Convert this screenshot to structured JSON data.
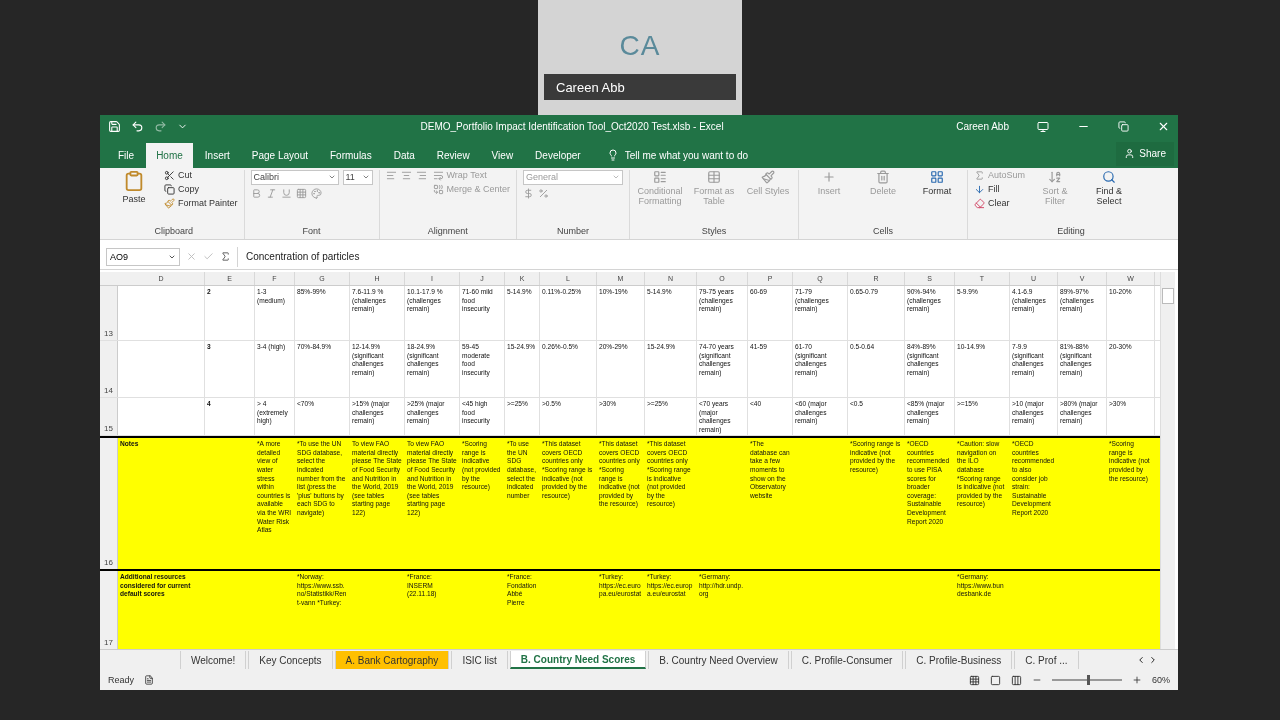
{
  "call": {
    "initials": "CA",
    "name": "Careen Abb"
  },
  "window": {
    "title": "DEMO_Portfolio Impact Identification Tool_Oct2020 Test.xlsb - Excel",
    "user": "Careen Abb"
  },
  "menu_tabs": [
    {
      "label": "File",
      "selected": false
    },
    {
      "label": "Home",
      "selected": true
    },
    {
      "label": "Insert",
      "selected": false
    },
    {
      "label": "Page Layout",
      "selected": false
    },
    {
      "label": "Formulas",
      "selected": false
    },
    {
      "label": "Data",
      "selected": false
    },
    {
      "label": "Review",
      "selected": false
    },
    {
      "label": "View",
      "selected": false
    },
    {
      "label": "Developer",
      "selected": false
    }
  ],
  "tell_me": {
    "placeholder": "Tell me what you want to do"
  },
  "share": "Share",
  "ribbon": {
    "clipboard": {
      "label": "Clipboard",
      "paste": "Paste",
      "cut": "Cut",
      "copy": "Copy",
      "format_painter": "Format Painter"
    },
    "font": {
      "label": "Font",
      "name": "Calibri",
      "size": "11"
    },
    "alignment": {
      "label": "Alignment",
      "wrap_text": "Wrap Text",
      "merge_center": "Merge & Center"
    },
    "number": {
      "label": "Number",
      "format": "General"
    },
    "styles": {
      "label": "Styles",
      "conditional_formatting": "Conditional Formatting",
      "format_as_table": "Format as Table",
      "cell_styles": "Cell Styles"
    },
    "cells": {
      "label": "Cells",
      "insert": "Insert",
      "delete": "Delete",
      "format": "Format"
    },
    "editing": {
      "label": "Editing",
      "autosum": "AutoSum",
      "fill": "Fill",
      "clear": "Clear",
      "sort_filter": "Sort & Filter",
      "find_select": "Find & Select"
    }
  },
  "formula_bar": {
    "name_box": "AO9",
    "value": "Concentration of particles"
  },
  "columns": [
    "D",
    "E",
    "F",
    "G",
    "H",
    "I",
    "J",
    "K",
    "L",
    "M",
    "N",
    "O",
    "P",
    "Q",
    "R",
    "S",
    "T",
    "U",
    "V",
    "W"
  ],
  "rows": [
    {
      "number": "13",
      "kind": "plain",
      "cells": [
        "",
        "2",
        "1-3 (medium)",
        "85%-99%",
        "7.6-11.9 % (challenges remain)",
        "10.1-17.9 % (challenges remain)",
        "71-60 mild food insecurity",
        "5-14.9%",
        "0.11%-0.25%",
        "10%-19%",
        "5-14.9%",
        "79-75 years (challenges remain)",
        "60-69",
        "71-79 (challenges remain)",
        "0.65-0.79",
        "90%-94% (challenges remain)",
        "5-9.9%",
        "4.1-6.9 (challenges remain)",
        "89%-97% (challenges remain)",
        "10-20%"
      ]
    },
    {
      "number": "14",
      "kind": "plain",
      "cells": [
        "",
        "3",
        "3-4 (high)",
        "70%-84.9%",
        "12-14.9% (significant challenges remain)",
        "18-24.9% (significant challenges remain)",
        "59-45 moderate food insecurity",
        "15-24.9%",
        "0.26%-0.5%",
        "20%-29%",
        "15-24.9%",
        "74-70 years (significant challenges remain)",
        "41-59",
        "61-70 (significant challenges remain)",
        "0.5-0.64",
        "84%-89% (significant challenges remain)",
        "10-14.9%",
        "7-9.9 (significant challenges remain)",
        "81%-88% (significant challenges remain)",
        "20-30%"
      ]
    },
    {
      "number": "15",
      "kind": "plain",
      "cells": [
        "",
        "4",
        "> 4 (extremely high)",
        "<70%",
        ">15% (major challenges remain)",
        ">25% (major challenges remain)",
        "<45 high food insecurity",
        ">=25%",
        ">0.5%",
        ">30%",
        ">=25%",
        "<70 years (major challenges remain)",
        "<40",
        "<60 (major challenges remain)",
        "<0.5",
        "<85% (major challenges remain)",
        ">=15%",
        ">10 (major challenges remain)",
        ">80% (major challenges remain)",
        ">30%"
      ]
    },
    {
      "number": "16",
      "kind": "notes",
      "cells": [
        "Notes",
        "",
        "*A more detailed view of water stress within countries is available via the WRI Water Risk Atlas",
        "*To use the UN SDG database, select the indicated number from the list (press the 'plus' buttons by each SDG to navigate)",
        "To view FAO material directly please The State of Food Security and Nutrition in the World, 2019 (see tables starting page 122)",
        "To view FAO material directly please The State of Food Security and Nutrition in the World, 2019 (see tables starting page 122)",
        "*Scoring range is indicative (not provided by the resource)",
        "*To use the UN SDG database, select the indicated number",
        "*This dataset covers OECD countries only *Scoring range is indicative (not provided by the resource)",
        "*This dataset covers OECD countries only *Scoring range is indicative (not provided by the resource)",
        "*This dataset covers OECD countries only *Scoring range is indicative (not provided by the resource)",
        "",
        "*The database can take a few moments to show on the Observatory website",
        "",
        "*Scoring range is indicative (not provided by the resource)",
        "*OECD countries recommended to use PISA scores for broader coverage: Sustainable Development Report 2020",
        "*Caution: slow navigation on the ILO database *Scoring range is indicative (not provided by the resource)",
        "*OECD countries recommended to also consider job strain: Sustainable Development Report 2020",
        "",
        "*Scoring range is indicative (not provided by the resource)"
      ]
    },
    {
      "number": "17",
      "kind": "notes",
      "cells": [
        "Additional resources considered for current default scores",
        "",
        "",
        "*Norway: https://www.ssb.no/Statistikk/Rent-vann *Turkey:",
        "",
        "*France: INSERM (22.11.18)",
        "",
        "*France: Fondation Abbé Pierre",
        "",
        "*Turkey: https://ec.europa.eu/eurostat",
        "*Turkey: https://ec.europa.eu/eurostat",
        "*Germany: http://hdr.undp.org",
        "",
        "",
        "",
        "",
        "*Germany: https://www.bundesbank.de",
        "",
        "",
        ""
      ]
    }
  ],
  "sheet_tabs": [
    {
      "label": "Welcome!",
      "selected": false
    },
    {
      "label": "Key Concepts",
      "selected": false
    },
    {
      "label": "A. Bank Cartography",
      "selected": false,
      "color": "#ffc000"
    },
    {
      "label": "ISIC list",
      "selected": false
    },
    {
      "label": "B. Country Need Scores",
      "selected": true
    },
    {
      "label": "B. Country Need Overview",
      "selected": false
    },
    {
      "label": "C. Profile-Consumer",
      "selected": false
    },
    {
      "label": "C. Profile-Business",
      "selected": false
    },
    {
      "label": "C. Prof ...",
      "selected": false
    }
  ],
  "status": {
    "mode": "Ready",
    "zoom": "60%",
    "level": 0.5
  }
}
